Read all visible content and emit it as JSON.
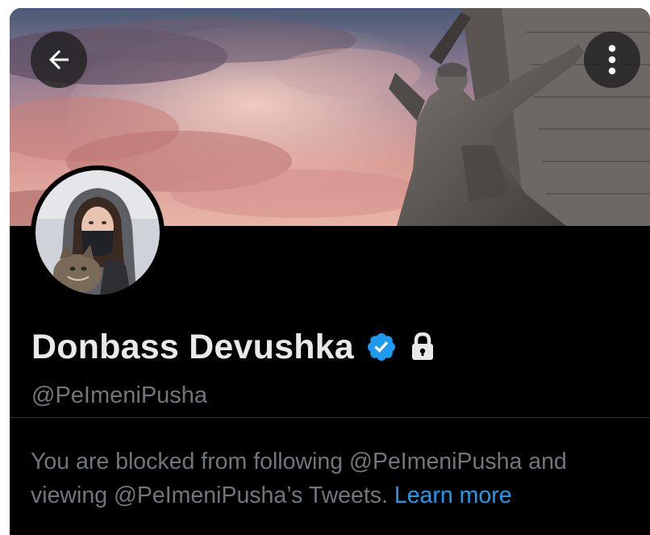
{
  "header": {
    "back_icon": "arrow-left-icon",
    "more_icon": "more-vertical-icon",
    "banner_image": "cloudy-sky-soldier-statue"
  },
  "profile": {
    "display_name": "Donbass Devushka",
    "handle": "@PeImeniPusha",
    "verified_icon": "verified-badge-icon",
    "verified_color": "#1d9bf0",
    "protected_icon": "lock-icon",
    "avatar_image": "woman-with-cat"
  },
  "notice": {
    "blocked_text": "You are blocked from following @PeImeniPusha and viewing @PeImeniPusha’s Tweets.",
    "learn_more_label": "Learn more",
    "link_color": "#1d9bf0"
  },
  "colors": {
    "background": "#000000",
    "primary_text": "#e7e9ea",
    "secondary_text": "#71767b",
    "divider": "#2f3336"
  }
}
